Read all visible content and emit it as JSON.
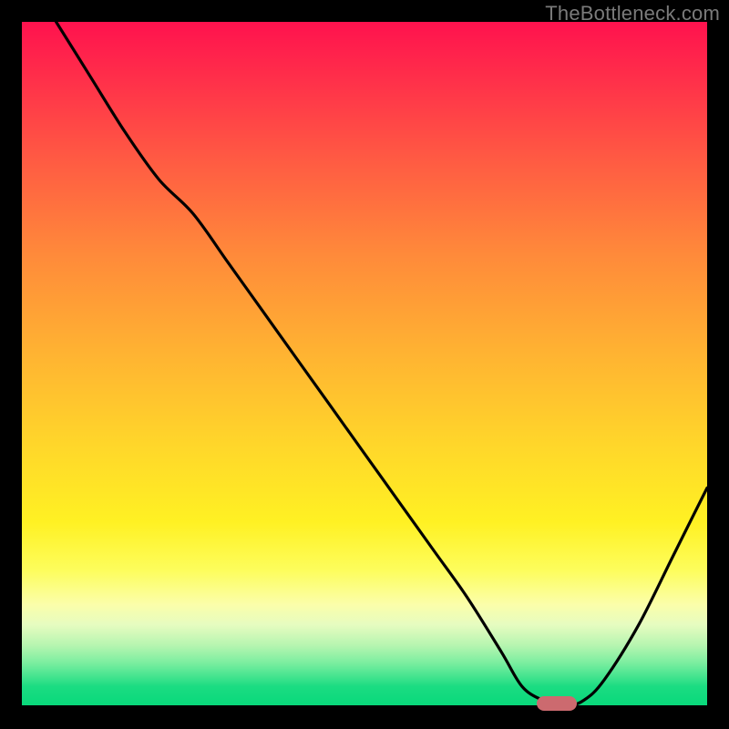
{
  "watermark": "TheBottleneck.com",
  "colors": {
    "frame": "#000000",
    "curve": "#000000",
    "marker": "#cc6a6f"
  },
  "chart_data": {
    "type": "line",
    "title": "",
    "xlabel": "",
    "ylabel": "",
    "xlim": [
      0,
      100
    ],
    "ylim": [
      0,
      100
    ],
    "note": "Axes are unitless percentage of plot area; no tick labels shown.",
    "series": [
      {
        "name": "bottleneck-curve",
        "x": [
          5,
          10,
          15,
          20,
          25,
          30,
          35,
          40,
          45,
          50,
          55,
          60,
          65,
          70,
          73,
          76,
          79,
          82,
          85,
          90,
          95,
          100
        ],
        "y": [
          100,
          92,
          84,
          77,
          72,
          65,
          58,
          51,
          44,
          37,
          30,
          23,
          16,
          8,
          3,
          1,
          0,
          1,
          4,
          12,
          22,
          32
        ]
      }
    ],
    "marker": {
      "x": 78,
      "y": 0.5,
      "shape": "rounded-bar"
    },
    "gradient_stops": [
      {
        "pos": 0.0,
        "color": "#ff124e"
      },
      {
        "pos": 0.2,
        "color": "#ff5a43"
      },
      {
        "pos": 0.48,
        "color": "#ffb232"
      },
      {
        "pos": 0.73,
        "color": "#fff123"
      },
      {
        "pos": 0.88,
        "color": "#e6fcc0"
      },
      {
        "pos": 1.0,
        "color": "#07d87a"
      }
    ]
  }
}
